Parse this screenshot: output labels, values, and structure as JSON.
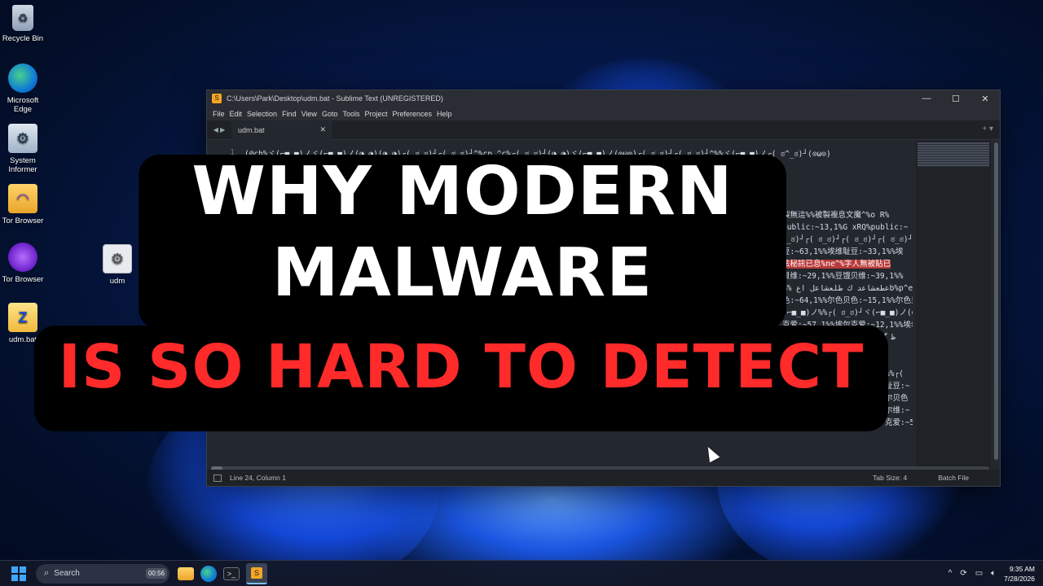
{
  "desktop": {
    "icons": [
      {
        "label": "Recycle Bin",
        "icon": "recycle-bin-icon"
      },
      {
        "label": "Microsoft Edge",
        "icon": "edge-icon"
      },
      {
        "label": "System Informer",
        "icon": "system-informer-icon"
      },
      {
        "label": "Tor Browser",
        "icon": "folder-icon"
      },
      {
        "label": "Tor Browser",
        "icon": "tor-browser-icon"
      },
      {
        "label": "udm",
        "icon": "gear-file-icon"
      },
      {
        "label": "udm.bat",
        "icon": "bat-file-icon"
      }
    ]
  },
  "window": {
    "title": "C:\\Users\\Park\\Desktop\\udm.bat - Sublime Text (UNREGISTERED)",
    "controls": {
      "minimize": "—",
      "maximize": "☐",
      "close": "✕"
    },
    "menu": [
      "File",
      "Edit",
      "Selection",
      "Find",
      "View",
      "Goto",
      "Tools",
      "Project",
      "Preferences",
      "Help"
    ],
    "tab": {
      "label": "udm.bat",
      "close": "✕"
    },
    "tab_actions": "+ ▾",
    "gutter": [
      "1",
      "",
      "",
      "",
      "",
      "",
      "",
      "",
      "",
      "",
      "",
      "",
      "",
      "",
      "1",
      "",
      "",
      "",
      "",
      "",
      "",
      "",
      "",
      ""
    ],
    "code_lines": [
      "(@ch%ヾ(⌐■_■)ノヾ(⌐■_■)ノ(◕‿◕)(◕‿◕)┌( ಠ_ಠ)┘┌( ಠ_ಠ)┘^%cp.^c%┌( ಠ_ಠ)┘(◕‿◕)ヾ(⌐■_■)ノ(⊙ω⊙)┌( ಠ_ಠ)┘┌( ಠ_ಠ)┘^%%ヾ(⌐■_■)ノ┌( ಠ^_ಠ)┘(⊙ω⊙)",
      "",
      "",
      "",
      "",
      "製無這%%被製複息文魔^%o R%",
      "public:~13,1%G xRQ%public:~",
      "ಠ_ಠ)┘┌( ಠ_ಠ)┘┌( ಠ_ಠ)┘┌( ಠ_ಠ)┘",
      "豆:~63,1%%埃维耻豆:~33,1%%埃",
      "法秘訊已息%ne^%字人無被貼已",
      "貝维:~29,1%%豆饿贝维:~39,1%%",
      "%%  عطعشاعد ك طلعشاعل اعb%p^e tmp')do",
      "色:~64,1%%尔色贝色:~15,1%%尔色贝色:~19,1%%尔",
      "(⌐■_■)ノ%%┌( ಠ_ಠ)┘ヾ(⌐■_■)ノ(⊙^w⊙)┌( ಠ_ಠ)┘",
      "克爱:~57,1%%埃尔克爱:~12,1%%埃尔克爱:~1,1%%埃",
      "文息%et e^%گ ی ت ج   G^ ﻇ  گ",
      "",
      "",
      "%%┌( ",
      "耻豆:~",
      "尔贝色",
      "尔维:~",
      "克爱:~5"
    ],
    "status": {
      "position": "Line 24, Column 1",
      "tab_size": "Tab Size: 4",
      "syntax": "Batch File"
    }
  },
  "overlay": {
    "line1": "WHY MODERN",
    "line2": "MALWARE",
    "line3": "IS SO HARD TO DETECT",
    "line3_color": "#ff2a2a"
  },
  "taskbar": {
    "search_label": "Search",
    "search_chip": "00:56",
    "apps": [
      "file-explorer-icon",
      "edge-icon",
      "terminal-icon",
      "sublime-text-icon"
    ],
    "tray": {
      "chevron": "^",
      "time": "9:35 AM",
      "date": "7/28/2026"
    }
  }
}
